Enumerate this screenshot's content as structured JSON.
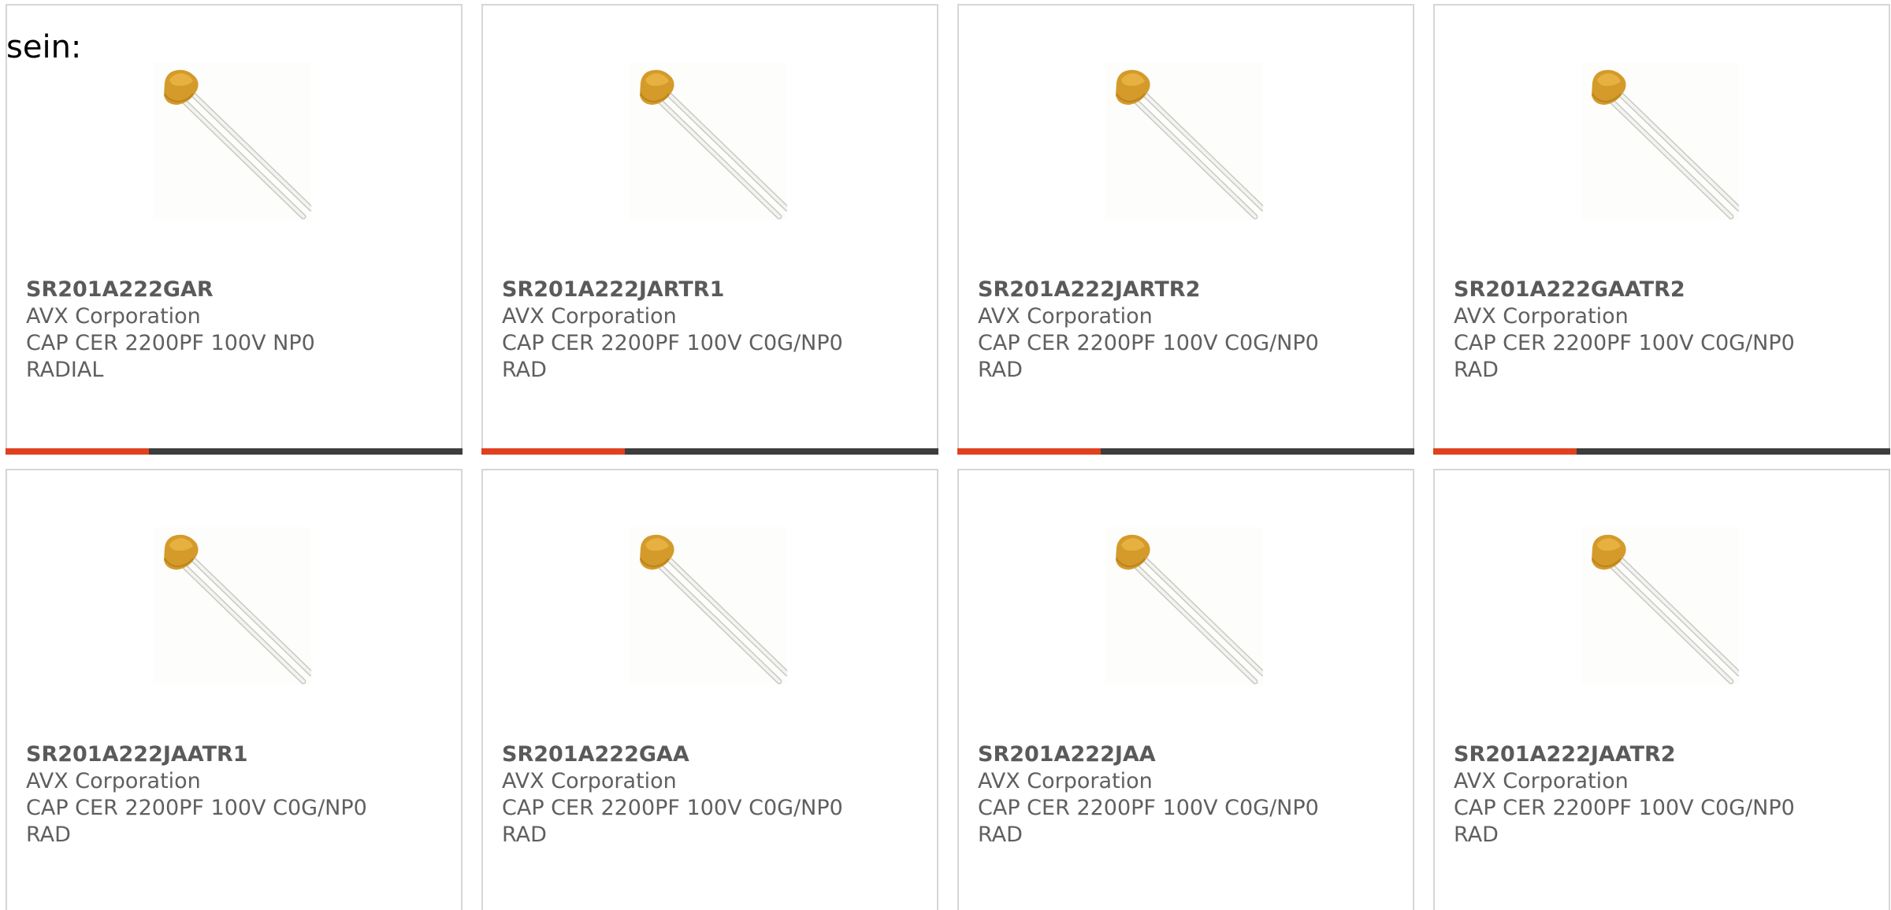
{
  "intro_text": "sein:",
  "colors": {
    "accent": "#e0401f",
    "bar": "#3d3d3d",
    "border": "#d6d6d6",
    "text": "#5f5f5f"
  },
  "products": [
    {
      "part_number": "SR201A222GAR",
      "manufacturer": "AVX Corporation",
      "description": "CAP CER 2200PF 100V NP0",
      "package": "RADIAL",
      "image_icon": "ceramic-capacitor-icon"
    },
    {
      "part_number": "SR201A222JARTR1",
      "manufacturer": "AVX Corporation",
      "description": "CAP CER 2200PF 100V C0G/NP0",
      "package": "RAD",
      "image_icon": "ceramic-capacitor-icon"
    },
    {
      "part_number": "SR201A222JARTR2",
      "manufacturer": "AVX Corporation",
      "description": "CAP CER 2200PF 100V C0G/NP0",
      "package": "RAD",
      "image_icon": "ceramic-capacitor-icon"
    },
    {
      "part_number": "SR201A222GAATR2",
      "manufacturer": "AVX Corporation",
      "description": "CAP CER 2200PF 100V C0G/NP0",
      "package": "RAD",
      "image_icon": "ceramic-capacitor-icon"
    },
    {
      "part_number": "SR201A222JAATR1",
      "manufacturer": "AVX Corporation",
      "description": "CAP CER 2200PF 100V C0G/NP0",
      "package": "RAD",
      "image_icon": "ceramic-capacitor-icon"
    },
    {
      "part_number": "SR201A222GAA",
      "manufacturer": "AVX Corporation",
      "description": "CAP CER 2200PF 100V C0G/NP0",
      "package": "RAD",
      "image_icon": "ceramic-capacitor-icon"
    },
    {
      "part_number": "SR201A222JAA",
      "manufacturer": "AVX Corporation",
      "description": "CAP CER 2200PF 100V C0G/NP0",
      "package": "RAD",
      "image_icon": "ceramic-capacitor-icon"
    },
    {
      "part_number": "SR201A222JAATR2",
      "manufacturer": "AVX Corporation",
      "description": "CAP CER 2200PF 100V C0G/NP0",
      "package": "RAD",
      "image_icon": "ceramic-capacitor-icon"
    }
  ]
}
